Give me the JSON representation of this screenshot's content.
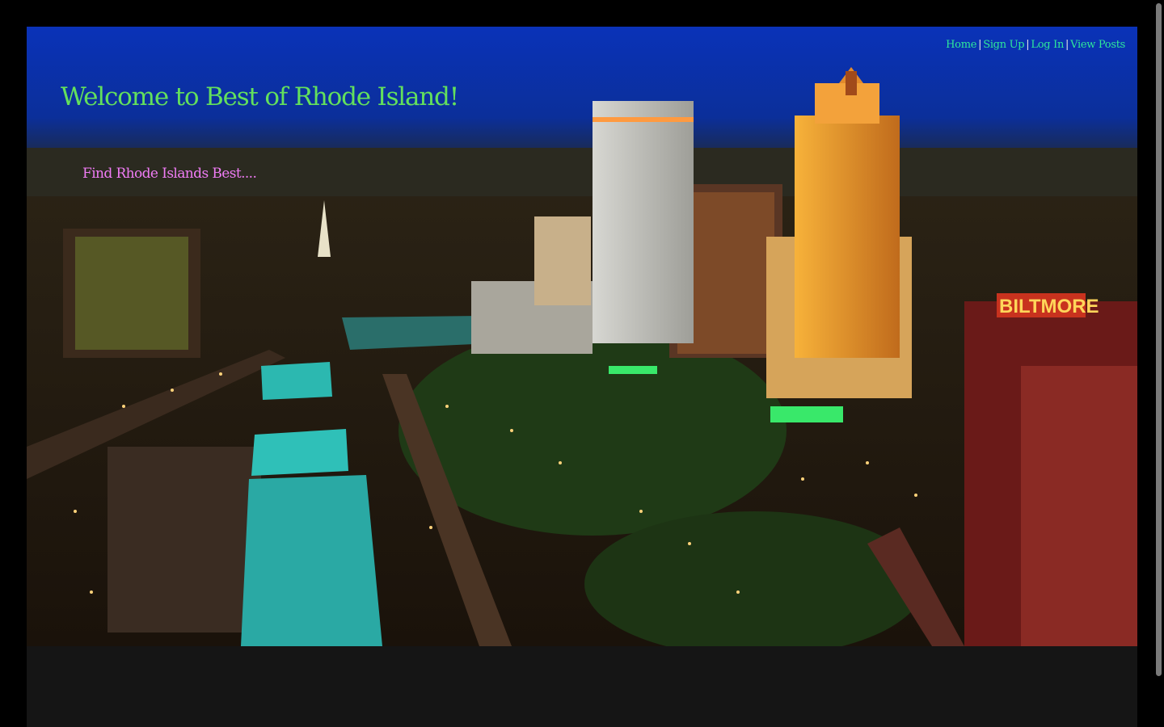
{
  "nav": {
    "links": [
      "Home",
      "Sign Up",
      "Log In",
      "View Posts"
    ],
    "separator": "|",
    "link_color": "#2ee89b"
  },
  "header": {
    "title": "Welcome to Best of Rhode Island!",
    "title_color": "#63e05c"
  },
  "main": {
    "tagline": "Find Rhode Islands Best....",
    "tagline_color": "#f07cf5"
  },
  "hero_image": {
    "subject": "Providence skyline at night",
    "sign_text": "BILTMORE"
  }
}
